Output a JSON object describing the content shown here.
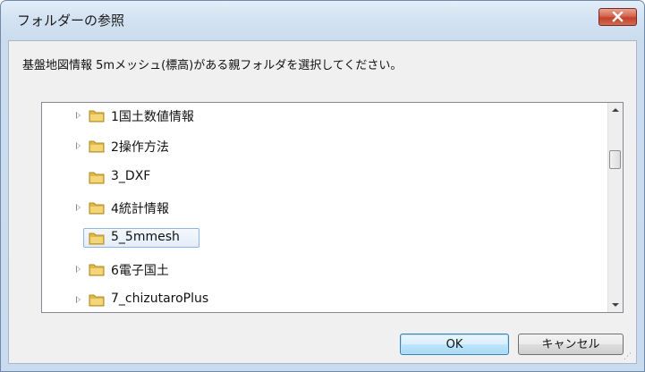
{
  "dialog": {
    "title": "フォルダーの参照",
    "instruction": "基盤地図情報 5mメッシュ(標高)がある親フォルダを選択してください。",
    "ok_label": "OK",
    "cancel_label": "キャンセル"
  },
  "tree": {
    "items": [
      {
        "label": "1国土数値情報",
        "expandable": true,
        "selected": false
      },
      {
        "label": "2操作方法",
        "expandable": true,
        "selected": false
      },
      {
        "label": "3_DXF",
        "expandable": false,
        "selected": false
      },
      {
        "label": "4統計情報",
        "expandable": true,
        "selected": false
      },
      {
        "label": "5_5mmesh",
        "expandable": false,
        "selected": true
      },
      {
        "label": "6電子国土",
        "expandable": true,
        "selected": false
      },
      {
        "label": "7_chizutaroPlus",
        "expandable": true,
        "selected": false
      }
    ]
  },
  "icons": {
    "close": "close-icon",
    "folder": "folder-icon",
    "expander": "chevron-right-icon",
    "scroll_up": "scroll-up-arrow",
    "scroll_down": "scroll-down-arrow"
  },
  "colors": {
    "selection_border": "#8fb5e6",
    "close_button": "#c2422b",
    "default_button_border": "#3c7fb1"
  }
}
